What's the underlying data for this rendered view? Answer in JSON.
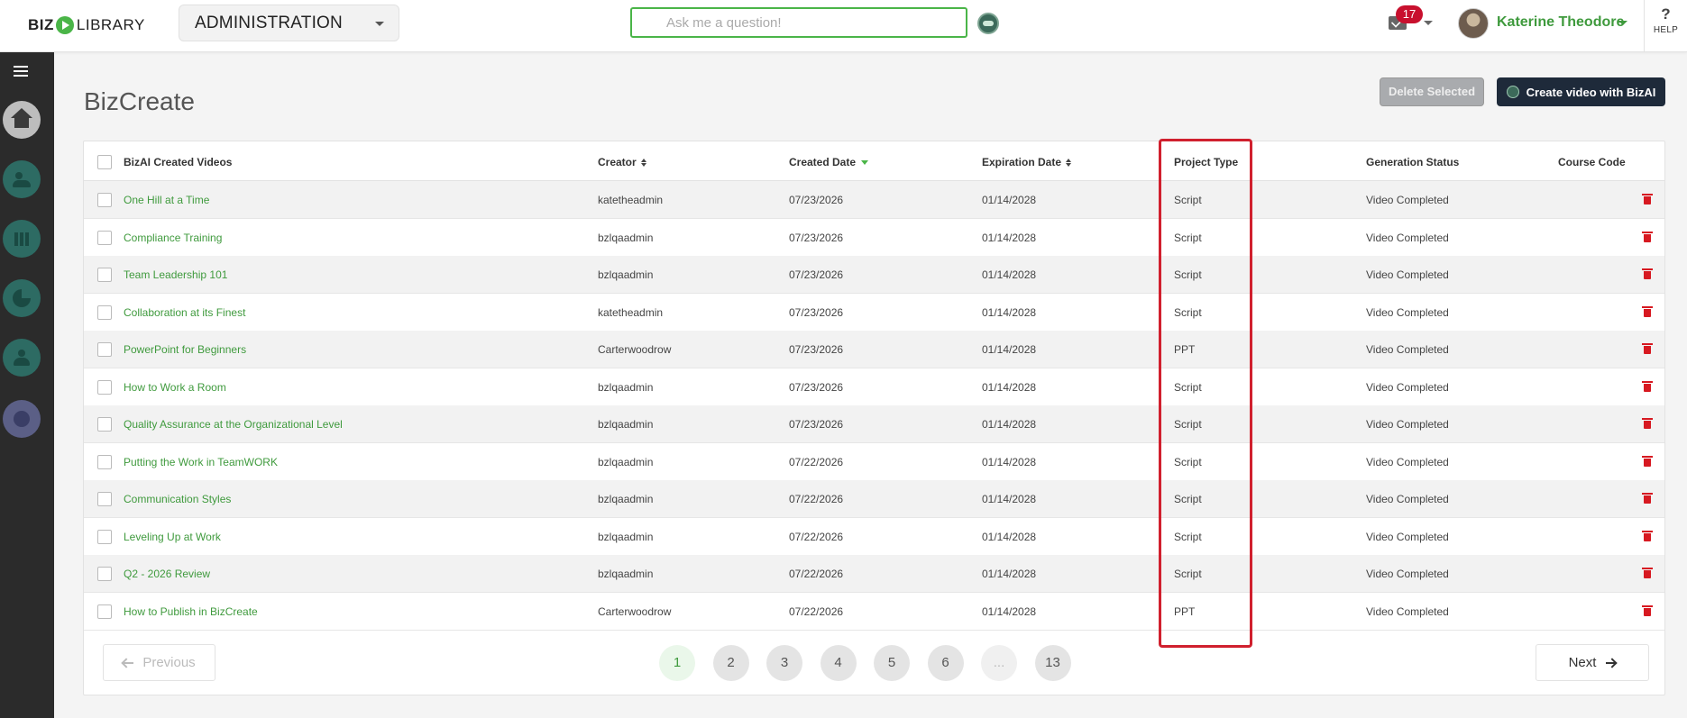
{
  "brand": {
    "biz": "BIZ",
    "library": "LIBRARY"
  },
  "portal_select": {
    "value": "ADMINISTRATION"
  },
  "ask": {
    "placeholder": "Ask me a question!"
  },
  "notifications": {
    "count": "17"
  },
  "user": {
    "name": "Katerine Theodore"
  },
  "help": {
    "label": "HELP"
  },
  "page": {
    "title": "BizCreate",
    "delete_label": "Delete Selected",
    "create_label": "Create video with BizAI"
  },
  "table": {
    "headers": {
      "videos": "BizAI Created Videos",
      "creator": "Creator",
      "created": "Created Date",
      "expiration": "Expiration Date",
      "project_type": "Project Type",
      "status": "Generation Status",
      "course_code": "Course Code"
    },
    "rows": [
      {
        "name": "One Hill at a Time",
        "creator": "katetheadmin",
        "created": "07/23/2026",
        "expiration": "01/14/2028",
        "type": "Script",
        "status": "Video Completed",
        "code": ""
      },
      {
        "name": "Compliance Training",
        "creator": "bzlqaadmin",
        "created": "07/23/2026",
        "expiration": "01/14/2028",
        "type": "Script",
        "status": "Video Completed",
        "code": ""
      },
      {
        "name": "Team Leadership 101",
        "creator": "bzlqaadmin",
        "created": "07/23/2026",
        "expiration": "01/14/2028",
        "type": "Script",
        "status": "Video Completed",
        "code": ""
      },
      {
        "name": "Collaboration at its Finest",
        "creator": "katetheadmin",
        "created": "07/23/2026",
        "expiration": "01/14/2028",
        "type": "Script",
        "status": "Video Completed",
        "code": ""
      },
      {
        "name": "PowerPoint for Beginners",
        "creator": "Carterwoodrow",
        "created": "07/23/2026",
        "expiration": "01/14/2028",
        "type": "PPT",
        "status": "Video Completed",
        "code": ""
      },
      {
        "name": "How to Work a Room",
        "creator": "bzlqaadmin",
        "created": "07/23/2026",
        "expiration": "01/14/2028",
        "type": "Script",
        "status": "Video Completed",
        "code": ""
      },
      {
        "name": "Quality Assurance at the Organizational Level",
        "creator": "bzlqaadmin",
        "created": "07/23/2026",
        "expiration": "01/14/2028",
        "type": "Script",
        "status": "Video Completed",
        "code": ""
      },
      {
        "name": "Putting the Work in TeamWORK",
        "creator": "bzlqaadmin",
        "created": "07/22/2026",
        "expiration": "01/14/2028",
        "type": "Script",
        "status": "Video Completed",
        "code": ""
      },
      {
        "name": "Communication Styles",
        "creator": "bzlqaadmin",
        "created": "07/22/2026",
        "expiration": "01/14/2028",
        "type": "Script",
        "status": "Video Completed",
        "code": ""
      },
      {
        "name": "Leveling Up at Work",
        "creator": "bzlqaadmin",
        "created": "07/22/2026",
        "expiration": "01/14/2028",
        "type": "Script",
        "status": "Video Completed",
        "code": ""
      },
      {
        "name": "Q2 - 2026 Review",
        "creator": "bzlqaadmin",
        "created": "07/22/2026",
        "expiration": "01/14/2028",
        "type": "Script",
        "status": "Video Completed",
        "code": ""
      },
      {
        "name": "How to Publish in BizCreate",
        "creator": "Carterwoodrow",
        "created": "07/22/2026",
        "expiration": "01/14/2028",
        "type": "PPT",
        "status": "Video Completed",
        "code": ""
      }
    ]
  },
  "pagination": {
    "previous_label": "Previous",
    "next_label": "Next",
    "pages": [
      "1",
      "2",
      "3",
      "4",
      "5",
      "6",
      "...",
      "13"
    ],
    "current": "1"
  },
  "colors": {
    "brand_green": "#4ab548",
    "link_green": "#3f9a3d",
    "highlight_red": "#d0202e",
    "delete_red": "#d71921",
    "create_button_bg": "#1e2a3a"
  }
}
